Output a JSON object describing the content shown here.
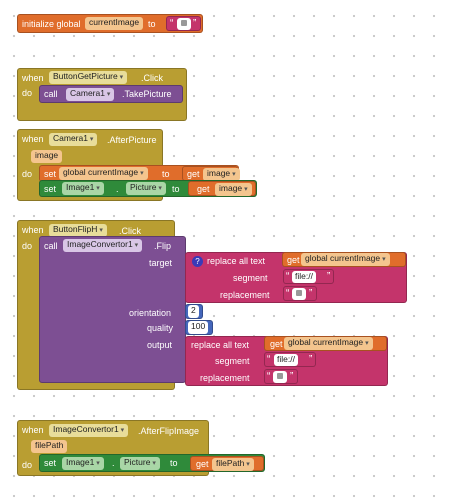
{
  "kw": {
    "initialize_global": "initialize global",
    "to": "to",
    "when": "when",
    "do": "do",
    "call": "call",
    "set": "set",
    "get": "get",
    "dot": ".",
    "click": ".Click",
    "after_picture": ".AfterPicture",
    "after_flip_image": ".AfterFlipImage",
    "flip": ".Flip",
    "take_picture": ".TakePicture",
    "global_current_image": "global currentImage",
    "replace_all_text": "replace all text",
    "segment": "segment",
    "replacement": "replacement",
    "target": "target",
    "orientation": "orientation",
    "quality": "quality",
    "output": "output",
    "quote_open": "“",
    "quote_close": "”"
  },
  "block1": {
    "var_name": "currentImage"
  },
  "block2": {
    "component": "ButtonGetPicture",
    "call_component": "Camera1"
  },
  "block3": {
    "component": "Camera1",
    "param": "image",
    "set_prop_component": "Image1",
    "set_prop": "Picture",
    "get_param": "image"
  },
  "block4": {
    "component": "ButtonFlipH",
    "call_component": "ImageConvertor1",
    "segment_text": "file://",
    "orientation_value": "2",
    "quality_value": "100"
  },
  "block5": {
    "component": "ImageConvertor1",
    "param": "filePath",
    "set_prop_component": "Image1",
    "set_prop": "Picture",
    "get_param": "filePath"
  },
  "colors": {
    "event": "#b99e32",
    "variable": "#e06d2b",
    "component": "#7d4f93",
    "setter": "#2f8a3a",
    "text": "#c4346b",
    "math": "#4466bb"
  }
}
